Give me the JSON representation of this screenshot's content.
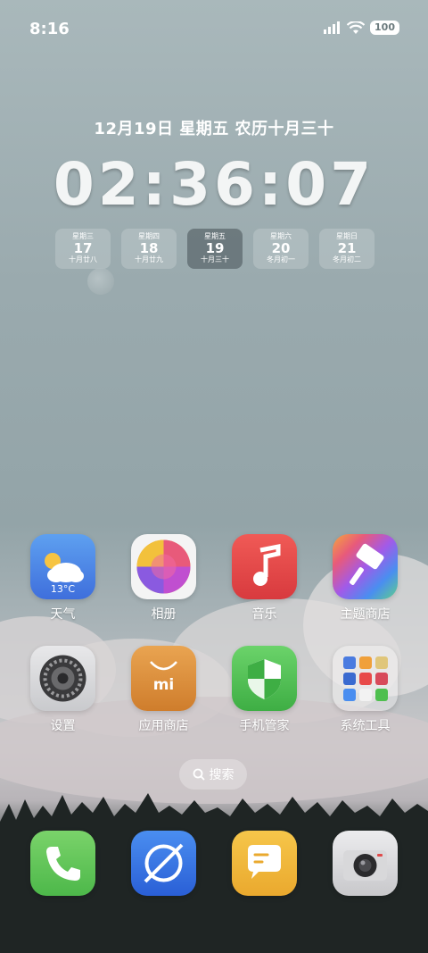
{
  "status_bar": {
    "time": "8:16",
    "battery": "100",
    "icons": [
      "signal-icon",
      "wifi-icon",
      "battery-icon"
    ]
  },
  "widget": {
    "date_line": "12月19日 星期五 农历十月三十",
    "clock": "02:36:07",
    "days": [
      {
        "week": "星期三",
        "num": "17",
        "lunar": "十月廿八"
      },
      {
        "week": "星期四",
        "num": "18",
        "lunar": "十月廿九"
      },
      {
        "week": "星期五",
        "num": "19",
        "lunar": "十月三十"
      },
      {
        "week": "星期六",
        "num": "20",
        "lunar": "冬月初一"
      },
      {
        "week": "星期日",
        "num": "21",
        "lunar": "冬月初二"
      }
    ]
  },
  "apps": [
    {
      "label": "天气",
      "icon": "weather-icon",
      "badge": "13°C"
    },
    {
      "label": "相册",
      "icon": "gallery-icon"
    },
    {
      "label": "音乐",
      "icon": "music-icon"
    },
    {
      "label": "主题商店",
      "icon": "themes-icon"
    },
    {
      "label": "设置",
      "icon": "settings-icon"
    },
    {
      "label": "应用商店",
      "icon": "app-store-icon",
      "glyph": "mi"
    },
    {
      "label": "手机管家",
      "icon": "security-icon"
    },
    {
      "label": "系统工具",
      "icon": "tools-folder-icon"
    }
  ],
  "search": {
    "label": "搜索",
    "icon": "search-icon"
  },
  "dock": [
    {
      "icon": "phone-icon"
    },
    {
      "icon": "browser-icon"
    },
    {
      "icon": "messages-icon"
    },
    {
      "icon": "camera-icon"
    }
  ],
  "colors": {
    "weather": "#4d86e6",
    "music": "#e4484b",
    "app_store": "#d98a3a",
    "security": "#4fbf4f",
    "phone": "#5dc64a",
    "browser": "#2c6fe0",
    "messages": "#f0b53a"
  }
}
